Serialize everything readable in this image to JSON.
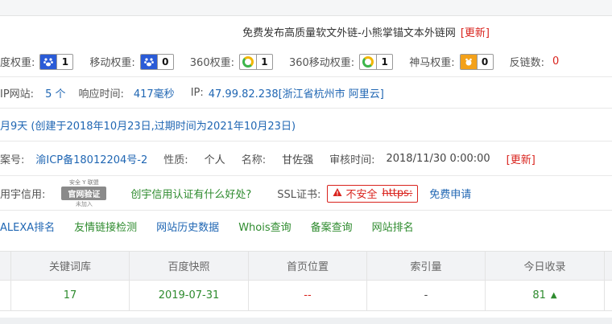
{
  "title": {
    "text": "免费发布高质量软文外链-小熊掌锚文本外链网",
    "update_label": "[更新]"
  },
  "weights": {
    "baidu_label": "度权重:",
    "baidu_value": "1",
    "mobile_label": "移动权重:",
    "mobile_value": "0",
    "so360_label": "360权重:",
    "so360_value": "1",
    "so360_mobile_label": "360移动权重:",
    "so360_mobile_value": "1",
    "shenma_label": "神马权重:",
    "shenma_value": "0",
    "backlinks_label": "反链数:",
    "backlinks_value": "0"
  },
  "site_info": {
    "ip_sites_label": "IP网站:",
    "ip_sites_value": "5 个",
    "response_label": "响应时间:",
    "response_value": "417毫秒",
    "ip_label": "IP:",
    "ip_value": "47.99.82.238[浙江省杭州市 阿里云]"
  },
  "domain_age": {
    "text": "月9天 (创建于2018年10月23日,过期时间为2021年10月23日)"
  },
  "icp": {
    "label": "案号:",
    "value": "渝ICP备18012204号-2",
    "nature_label": "性质:",
    "nature_value": "个人",
    "name_label": "名称:",
    "name_value": "甘佐强",
    "audit_label": "审核时间:",
    "audit_value": "2018/11/30 0:00:00",
    "update_label": "[更新]"
  },
  "credit": {
    "label": "用宇信用:",
    "seal_top": "安全 Y 联盟",
    "seal_mid": "官网验证",
    "seal_bot": "未加入",
    "link_text": "创宇信用认证有什么好处?",
    "ssl_label": "SSL证书:",
    "unsafe_text": "不安全",
    "https_text": "https:",
    "apply_text": "免费申请"
  },
  "links": [
    "ALEXA排名",
    "友情链接检测",
    "网站历史数据",
    "Whois查询",
    "备案查询",
    "网站排名"
  ],
  "table": {
    "headers": [
      "关键词库",
      "百度快照",
      "首页位置",
      "索引量",
      "今日收录"
    ],
    "row": [
      "17",
      "2019-07-31",
      "--",
      "-",
      "81"
    ]
  },
  "colors": {
    "accent_blue": "#1f66b3",
    "accent_red": "#d9231d",
    "accent_green": "#2e8b2e"
  }
}
